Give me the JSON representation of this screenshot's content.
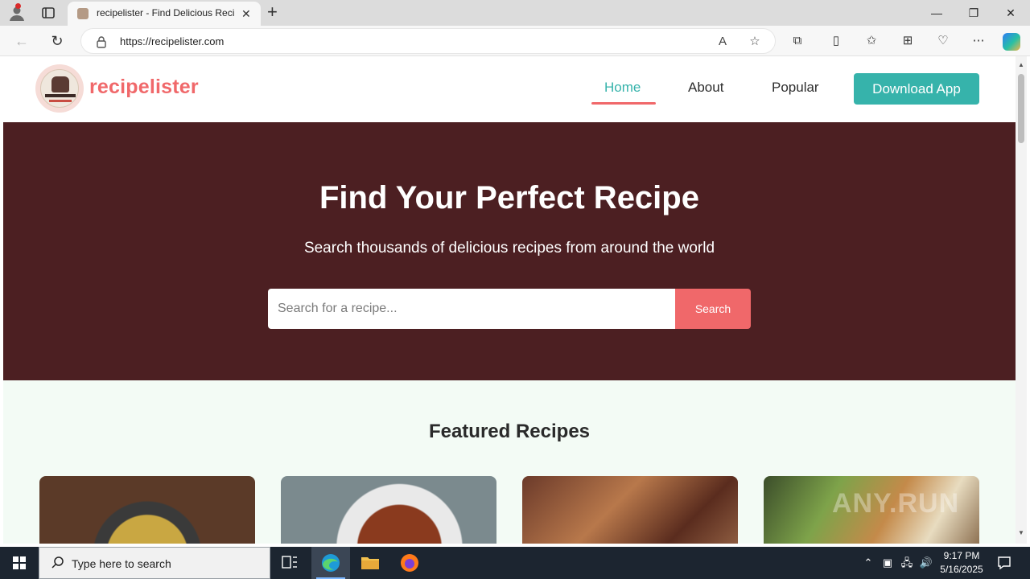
{
  "browser": {
    "tab_title": "recipelister - Find Delicious Recipes",
    "url": "https://recipelister.com",
    "icons": [
      "profile-icon",
      "tab-actions-icon",
      "close-icon",
      "new-tab-icon",
      "minimize-icon",
      "restore-icon",
      "window-close-icon",
      "back-icon",
      "refresh-icon",
      "lock-icon",
      "read-aloud-icon",
      "favorite-star-icon",
      "extensions-icon",
      "split-screen-icon",
      "favorites-icon",
      "collections-icon",
      "browser-essentials-icon",
      "more-icon",
      "copilot-icon"
    ]
  },
  "site": {
    "brand": "recipelister",
    "nav": {
      "home": "Home",
      "about": "About",
      "popular": "Popular",
      "download": "Download App"
    },
    "hero": {
      "title": "Find Your Perfect Recipe",
      "subtitle": "Search thousands of delicious recipes from around the world",
      "search_placeholder": "Search for a recipe...",
      "search_button": "Search"
    },
    "featured_title": "Featured Recipes",
    "watermark": "ANY.RUN",
    "colors": {
      "brand": "#f0686a",
      "accent": "#36b3ab",
      "hero_bg": "#4c1f22",
      "section_bg": "#f3fbf5"
    }
  },
  "taskbar": {
    "search_placeholder": "Type here to search",
    "time": "9:17 PM",
    "date": "5/16/2025"
  }
}
